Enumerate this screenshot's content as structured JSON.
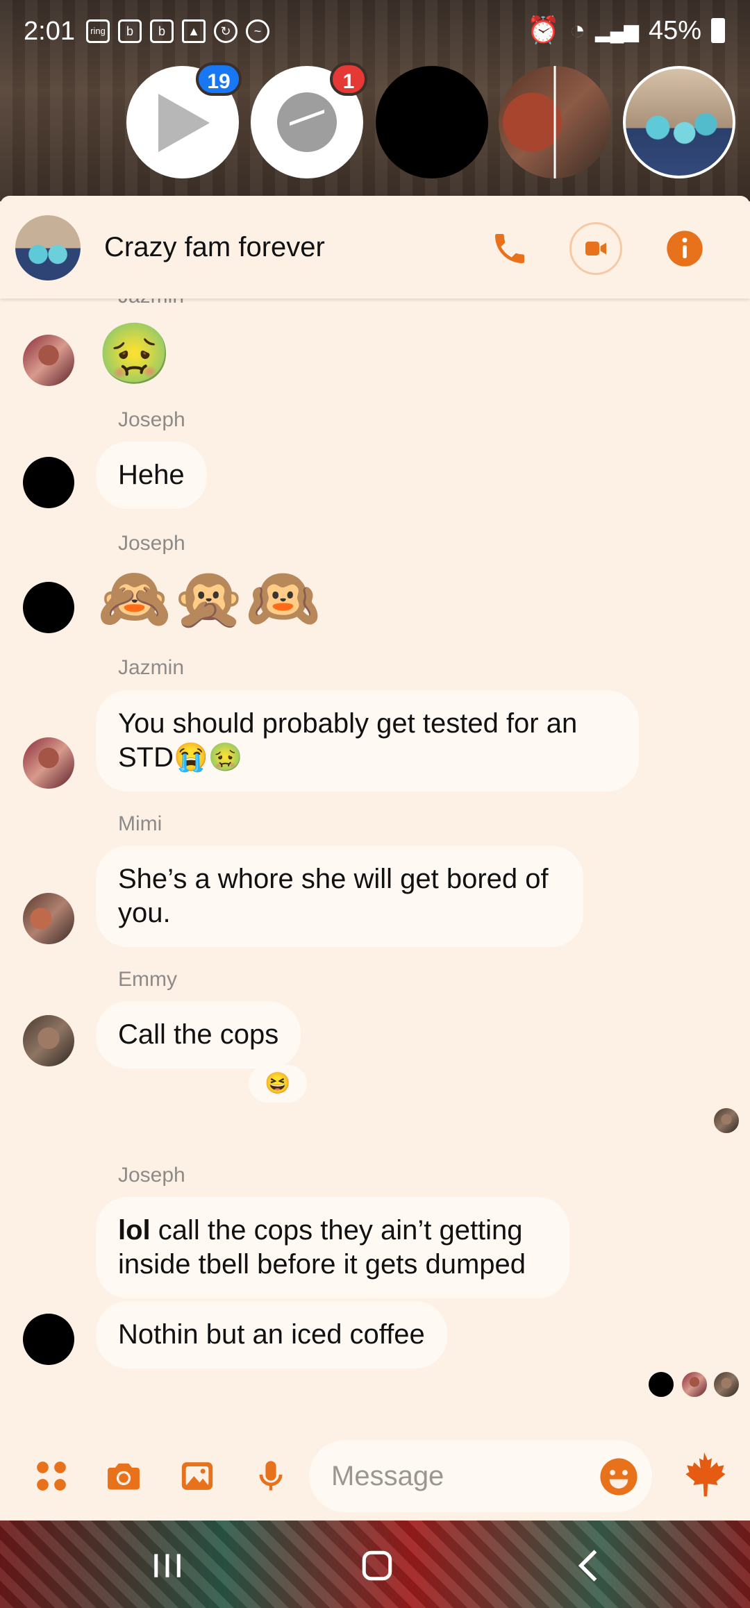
{
  "status_bar": {
    "time": "2:01",
    "left_icons": [
      "ring",
      "b",
      "b",
      "image-icon",
      "sync-icon",
      "messenger-icon"
    ],
    "battery": "45%"
  },
  "chat_heads": {
    "play_badge": "19",
    "messenger_badge": "1"
  },
  "header": {
    "title": "Crazy fam forever"
  },
  "messages": {
    "clipped_name": "Jazmin",
    "m1_emoji": "🤢",
    "joseph1_name": "Joseph",
    "joseph1_text": "Hehe",
    "joseph2_name": "Joseph",
    "joseph2_emoji": "🙈🙊🙉",
    "jazmin_name": "Jazmin",
    "jazmin_text": "You should probably get tested for an STD😭🤢",
    "mimi_name": "Mimi",
    "mimi_text": "She’s a whore she will get bored of you.",
    "emmy_name": "Emmy",
    "emmy_text": "Call the cops",
    "emmy_reaction": "😆",
    "joseph3_name": "Joseph",
    "joseph3_bold": "lol",
    "joseph3_text": " call the cops they ain’t getting inside tbell before it gets dumped",
    "joseph4_text": "Nothin but an iced coffee"
  },
  "composer": {
    "placeholder": "Message"
  },
  "colors": {
    "accent": "#e8711b",
    "background": "#fdf1e6",
    "bubble": "#fff9f4"
  }
}
